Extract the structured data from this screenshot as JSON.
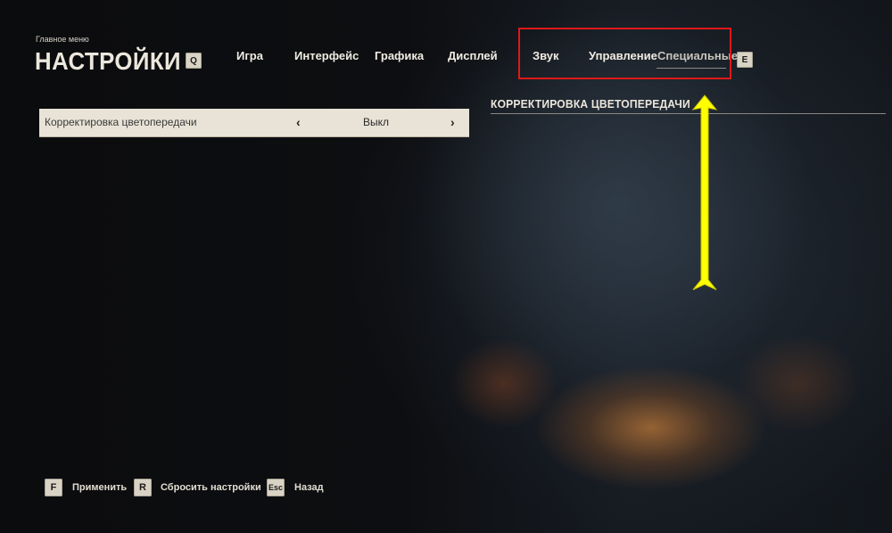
{
  "header": {
    "breadcrumb": "Главное меню",
    "title": "НАСТРОЙКИ",
    "prev_key": "Q",
    "next_key": "E"
  },
  "tabs": [
    {
      "label": "Игра"
    },
    {
      "label": "Интерфейс"
    },
    {
      "label": "Графика"
    },
    {
      "label": "Дисплей"
    },
    {
      "label": "Звук"
    },
    {
      "label": "Управление"
    },
    {
      "label": "Специальные",
      "active": true
    }
  ],
  "settings": [
    {
      "label": "Корректировка цветопередачи",
      "value": "Выкл",
      "prev_arrow": "‹",
      "next_arrow": "›"
    }
  ],
  "detail_panel": {
    "title": "КОРРЕКТИРОВКА ЦВЕТОПЕРЕДАЧИ"
  },
  "footer": {
    "apply": {
      "key": "F",
      "label": "Применить"
    },
    "reset": {
      "key": "R",
      "label": "Сбросить настройки"
    },
    "back": {
      "key": "Esc",
      "label": "Назад"
    }
  },
  "annotations": {
    "highlight_color": "#e01818",
    "arrow_color": "#ffff00"
  }
}
